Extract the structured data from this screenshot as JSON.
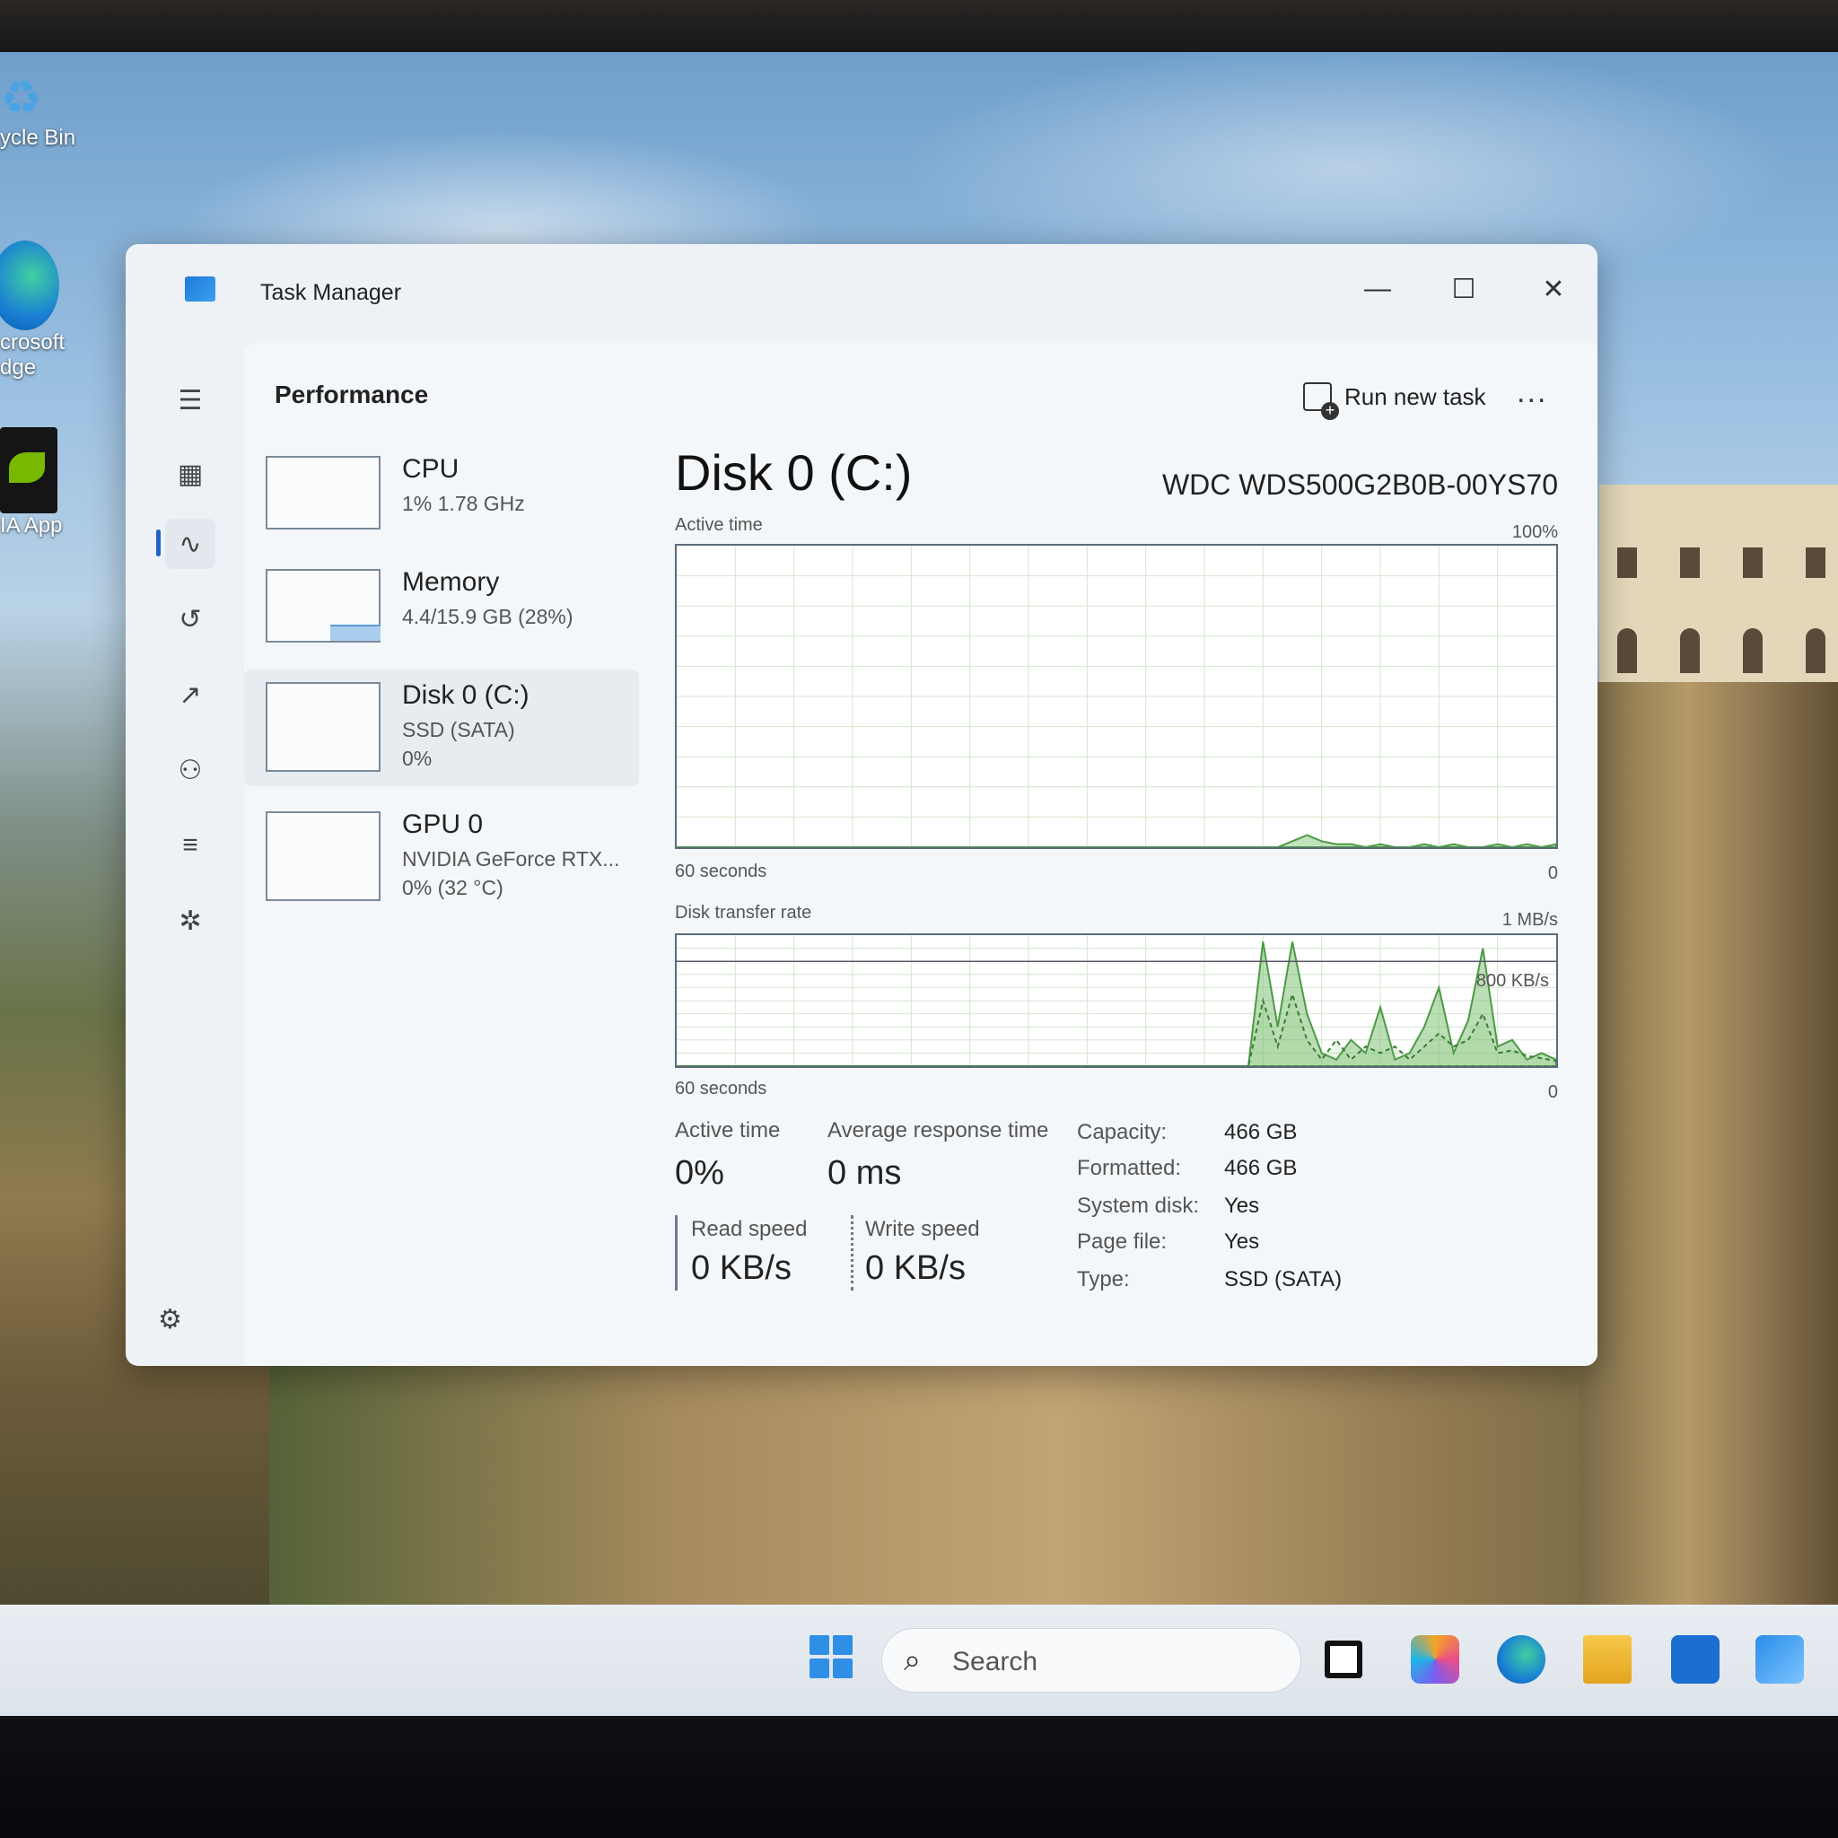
{
  "desktop": {
    "icons": [
      {
        "label": "ycle Bin"
      },
      {
        "label": "crosoft",
        "label2": "dge"
      },
      {
        "label": "IA App"
      }
    ]
  },
  "window": {
    "title": "Task Manager",
    "controls": {
      "minimize": "—",
      "maximize": "☐",
      "close": "✕"
    }
  },
  "header": {
    "section_title": "Performance",
    "run_new_task": "Run new task",
    "more": "..."
  },
  "devices": [
    {
      "name": "CPU",
      "line1": "1%  1.78 GHz",
      "line2": ""
    },
    {
      "name": "Memory",
      "line1": "4.4/15.9 GB (28%)",
      "line2": ""
    },
    {
      "name": "Disk 0 (C:)",
      "line1": "SSD (SATA)",
      "line2": "0%"
    },
    {
      "name": "GPU 0",
      "line1": "NVIDIA GeForce RTX...",
      "line2": "0%  (32 °C)"
    }
  ],
  "memory_usage_fraction": 0.28,
  "detail": {
    "title": "Disk 0 (C:)",
    "model": "WDC  WDS500G2B0B-00YS70",
    "active_time_graph": {
      "label": "Active time",
      "max_label": "100%",
      "x_label": "60 seconds",
      "min_label": "0"
    },
    "transfer_graph": {
      "label": "Disk transfer rate",
      "max_label": "1 MB/s",
      "mid_label": "800 KB/s",
      "x_label": "60 seconds",
      "min_label": "0"
    },
    "stats": {
      "active_time_label": "Active time",
      "active_time_value": "0%",
      "avg_response_label": "Average response time",
      "avg_response_value": "0 ms",
      "read_label": "Read speed",
      "read_value": "0 KB/s",
      "write_label": "Write speed",
      "write_value": "0 KB/s"
    },
    "properties": [
      {
        "label": "Capacity:",
        "value": "466 GB"
      },
      {
        "label": "Formatted:",
        "value": "466 GB"
      },
      {
        "label": "System disk:",
        "value": "Yes"
      },
      {
        "label": "Page file:",
        "value": "Yes"
      },
      {
        "label": "Type:",
        "value": "SSD (SATA)"
      }
    ]
  },
  "taskbar": {
    "search_placeholder": "Search"
  },
  "chart_data": [
    {
      "type": "area",
      "title": "Active time",
      "x": [
        0,
        5,
        10,
        15,
        20,
        25,
        30,
        35,
        40,
        41,
        42,
        43,
        44,
        45,
        46,
        47,
        48,
        49,
        50,
        51,
        52,
        53,
        54,
        55,
        56,
        57,
        58,
        59,
        60
      ],
      "values": [
        0,
        0,
        0,
        0,
        0,
        0,
        0,
        0,
        0,
        0,
        2,
        4,
        2,
        1,
        1,
        0,
        1,
        0,
        0,
        1,
        0,
        1,
        0,
        0,
        1,
        0,
        1,
        0,
        1
      ],
      "ylim": [
        0,
        100
      ],
      "xlabel": "60 seconds",
      "ylabel": ""
    },
    {
      "type": "area",
      "title": "Disk transfer rate",
      "unit": "KB/s",
      "ylim": [
        0,
        1000
      ],
      "series": [
        {
          "x": [
            0,
            39,
            40,
            41,
            42,
            43,
            44,
            45,
            46,
            47,
            48,
            49,
            50,
            51,
            52,
            53,
            54,
            55,
            56,
            57,
            58,
            59,
            60
          ],
          "values": [
            0,
            0,
            950,
            300,
            950,
            400,
            100,
            50,
            200,
            100,
            450,
            50,
            100,
            300,
            600,
            100,
            350,
            900,
            150,
            200,
            50,
            100,
            50
          ]
        },
        {
          "x": [
            0,
            39,
            40,
            41,
            42,
            43,
            44,
            45,
            46,
            47,
            48,
            49,
            50,
            51,
            52,
            53,
            54,
            55,
            56,
            57,
            58,
            59,
            60
          ],
          "values": [
            0,
            0,
            500,
            150,
            550,
            200,
            50,
            200,
            50,
            150,
            100,
            150,
            50,
            150,
            250,
            150,
            200,
            400,
            100,
            120,
            80,
            60,
            40
          ]
        }
      ]
    }
  ]
}
